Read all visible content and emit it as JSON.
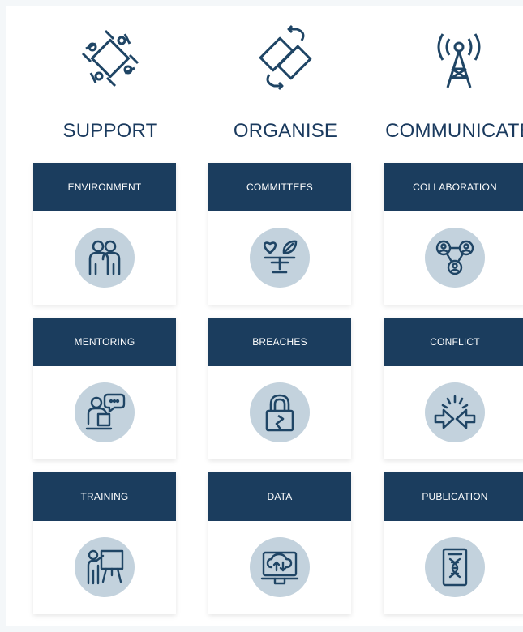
{
  "columns": [
    {
      "title": "SUPPORT",
      "icon": "teamwork-hands-icon",
      "cards": [
        {
          "label": "ENVIRONMENT",
          "icon": "people-pair-icon"
        },
        {
          "label": "MENTORING",
          "icon": "mentor-chat-icon"
        },
        {
          "label": "TRAINING",
          "icon": "presentation-board-icon"
        }
      ]
    },
    {
      "title": "ORGANISE",
      "icon": "sync-arrows-icon",
      "cards": [
        {
          "label": "COMMITTEES",
          "icon": "heart-leaf-balance-icon"
        },
        {
          "label": "BREACHES",
          "icon": "broken-padlock-icon"
        },
        {
          "label": "DATA",
          "icon": "cloud-computer-icon"
        }
      ]
    },
    {
      "title": "COMMUNICATE",
      "icon": "radio-tower-icon",
      "cards": [
        {
          "label": "COLLABORATION",
          "icon": "network-people-icon"
        },
        {
          "label": "CONFLICT",
          "icon": "opposing-arrows-icon"
        },
        {
          "label": "PUBLICATION",
          "icon": "dna-document-icon"
        }
      ]
    }
  ],
  "colors": {
    "navy": "#1b3d5e",
    "disc": "#c3d2dd",
    "icon": "#1f4565"
  }
}
